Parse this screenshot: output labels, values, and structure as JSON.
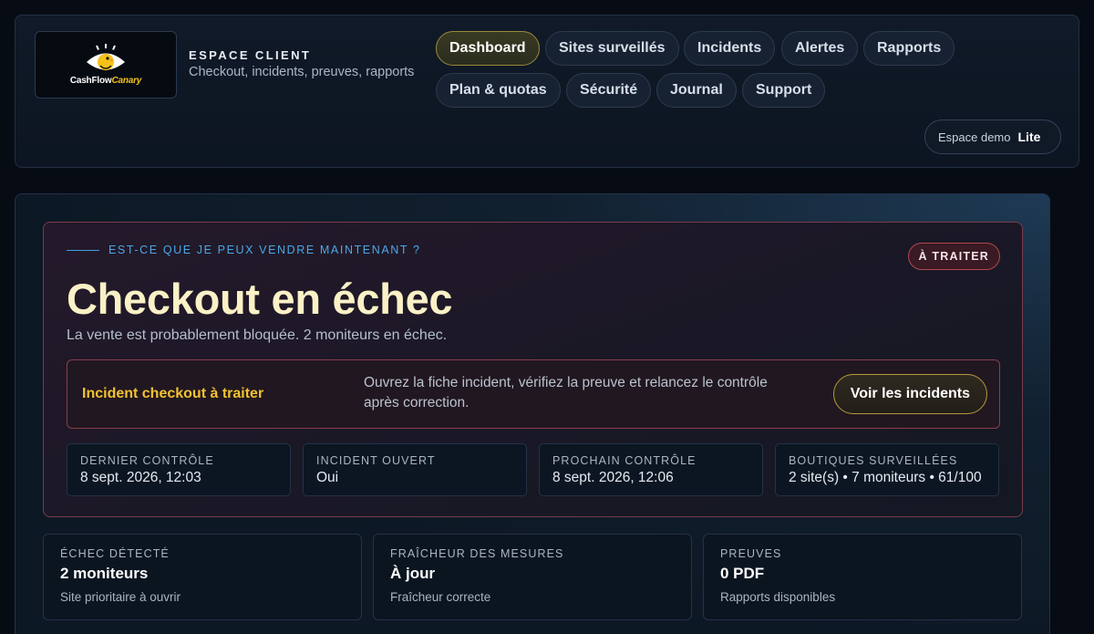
{
  "brand": {
    "logo_text_white": "CashFlow",
    "logo_text_yellow": "Canary",
    "logo_icon": "eye-canary-icon",
    "section_title": "ESPACE CLIENT",
    "section_subtitle": "Checkout, incidents, preuves, rapports"
  },
  "nav": {
    "items": [
      {
        "label": "Dashboard",
        "active": true
      },
      {
        "label": "Sites surveillés",
        "active": false
      },
      {
        "label": "Incidents",
        "active": false
      },
      {
        "label": "Alertes",
        "active": false
      },
      {
        "label": "Rapports",
        "active": false
      },
      {
        "label": "Plan & quotas",
        "active": false
      },
      {
        "label": "Sécurité",
        "active": false
      },
      {
        "label": "Journal",
        "active": false
      },
      {
        "label": "Support",
        "active": false
      }
    ]
  },
  "workspace": {
    "label": "Espace demo",
    "plan": "Lite"
  },
  "status": {
    "eyebrow": "EST-CE QUE JE PEUX VENDRE MAINTENANT ?",
    "chip": "À TRAITER",
    "title": "Checkout en échec",
    "subtitle": "La vente est probablement bloquée. 2 moniteurs en échec.",
    "action": {
      "label": "Incident checkout à traiter",
      "description": "Ouvrez la fiche incident, vérifiez la preuve et relancez le contrôle après correction.",
      "button": "Voir les incidents"
    },
    "stats": [
      {
        "key": "DERNIER CONTRÔLE",
        "value": "8 sept. 2026, 12:03"
      },
      {
        "key": "INCIDENT OUVERT",
        "value": "Oui"
      },
      {
        "key": "PROCHAIN CONTRÔLE",
        "value": "8 sept. 2026, 12:06"
      },
      {
        "key": "BOUTIQUES SURVEILLÉES",
        "value": "2 site(s) • 7 moniteurs • 61/100"
      }
    ]
  },
  "summary": [
    {
      "key": "ÉCHEC DÉTECTÉ",
      "value": "2 moniteurs",
      "hint": "Site prioritaire à ouvrir"
    },
    {
      "key": "FRAÎCHEUR DES MESURES",
      "value": "À jour",
      "hint": "Fraîcheur correcte"
    },
    {
      "key": "PREUVES",
      "value": "0 PDF",
      "hint": "Rapports disponibles"
    }
  ],
  "colors": {
    "accent_yellow": "#f2c230",
    "danger_border": "#8a3e4a",
    "eyebrow_blue": "#4aa8e6",
    "title_cream": "#fbf1c6"
  }
}
